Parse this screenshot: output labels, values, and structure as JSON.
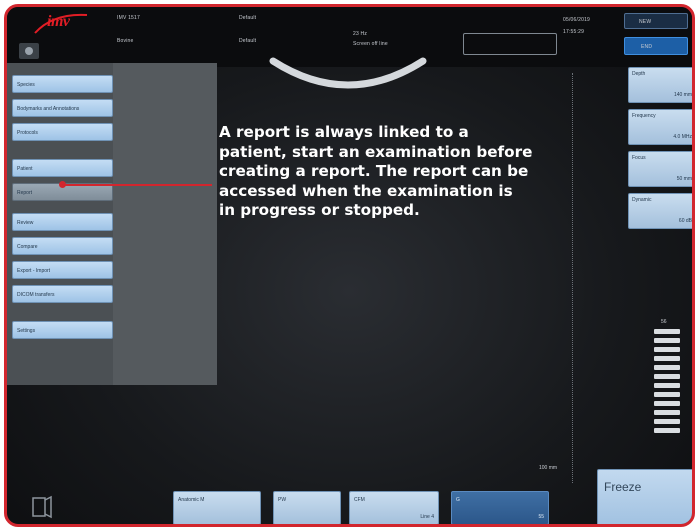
{
  "screen": {
    "logo": "imv",
    "top_info": {
      "patient_id": "IMV 1517",
      "preset": "Default",
      "operator": "Bovine",
      "preset2": "Default",
      "frame_rate": "23 Hz",
      "status": "Screen off line",
      "date": "05/06/2019",
      "time": "17:55:29"
    },
    "top_buttons": {
      "new": "NEW",
      "end": "END"
    }
  },
  "left_menu": {
    "items": [
      {
        "label": "Species"
      },
      {
        "label": "Bodymarks and Annotations"
      },
      {
        "label": "Protocols"
      },
      {
        "label": "Patient"
      },
      {
        "label": "Report"
      },
      {
        "label": "Review"
      },
      {
        "label": "Compare"
      },
      {
        "label": "Export - Import"
      },
      {
        "label": "DICOM transfers"
      },
      {
        "label": "Settings"
      }
    ]
  },
  "params": [
    {
      "label": "Depth",
      "value": "140 mm"
    },
    {
      "label": "Frequency",
      "value": "4.0 MHz"
    },
    {
      "label": "Focus",
      "value": "50 mm"
    },
    {
      "label": "Dynamic",
      "value": "60 dB"
    }
  ],
  "gain_ladder_value": "56",
  "scale_label": "100 mm",
  "bottom": {
    "buttons": [
      {
        "label": "Anatomic M",
        "value": ""
      },
      {
        "label": "PW",
        "value": ""
      },
      {
        "label": "CFM",
        "value": "Line 4"
      },
      {
        "label": "G",
        "value": "55"
      }
    ],
    "freeze": "Freeze"
  },
  "annotation": {
    "lines": [
      "A report is always linked to a",
      "patient, start an examination before",
      "creating a report. The report can be",
      "accessed when the examination is",
      "in progress or stopped."
    ]
  },
  "colors": {
    "accent": "#d2262e",
    "button": "#a4c0dc",
    "active": "#1d5fa6"
  }
}
